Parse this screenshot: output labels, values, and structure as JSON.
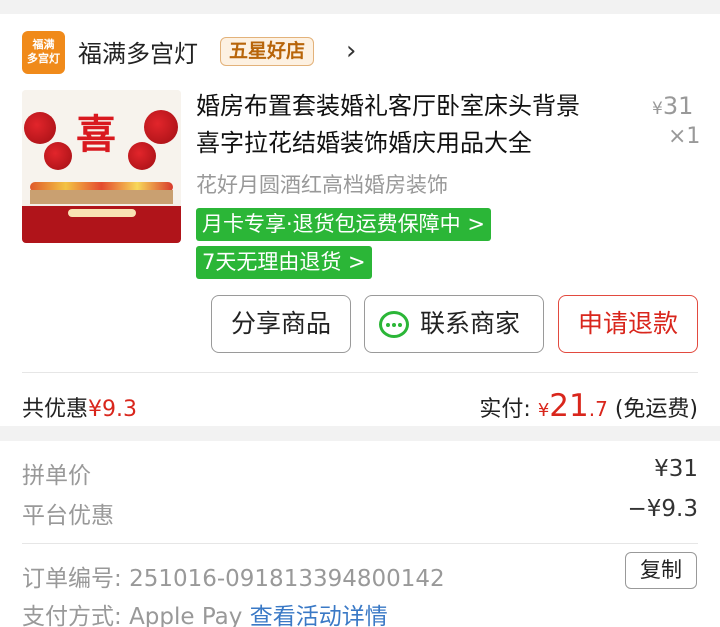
{
  "shop": {
    "logo_line1": "福满",
    "logo_line2": "多宫灯",
    "name": "福满多宫灯",
    "badge": "五星好店"
  },
  "product": {
    "title_line1": "婚房布置套装婚礼客厅卧室床头背景",
    "title_line2": "喜字拉花结婚装饰婚庆用品大全",
    "price_symbol": "¥",
    "price": "31",
    "quantity": "×1",
    "variant": "花好月圆酒红高档婚房装饰",
    "tag1": "月卡专享·退货包运费保障中 >",
    "tag2": "7天无理由退货 >",
    "image_caption": "喜"
  },
  "actions": {
    "share": "分享商品",
    "contact": "联系商家",
    "refund": "申请退款"
  },
  "summary": {
    "discount_label": "共优惠",
    "discount_amount": "¥9.3",
    "paid_label": "实付:",
    "paid_symbol": "¥",
    "paid_int": "21",
    "paid_dec": ".7",
    "shipping_note": "(免运费)"
  },
  "details": {
    "group_price_label": "拼单价",
    "group_price": "¥31",
    "platform_discount_label": "平台优惠",
    "platform_discount": "−¥9.3",
    "order_no_label": "订单编号:",
    "order_no": "251016-091813394800142",
    "copy": "复制",
    "payment_label": "支付方式:",
    "payment_method": "Apple Pay",
    "activity_link": "查看活动详情"
  },
  "colors": {
    "accent_red": "#d9261c",
    "green": "#2bb637",
    "link_blue": "#3a79c6"
  }
}
